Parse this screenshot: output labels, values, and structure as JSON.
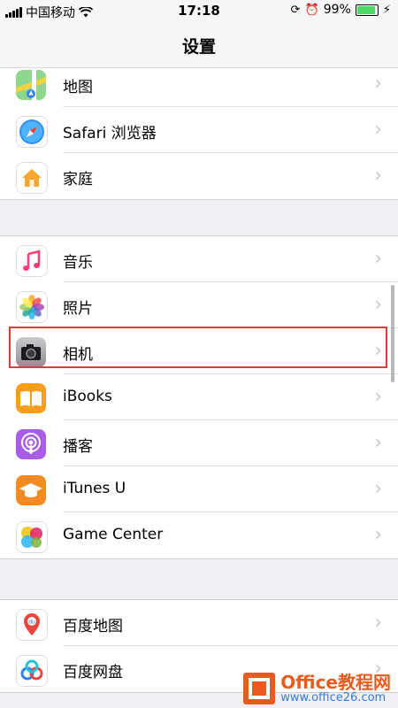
{
  "status_bar": {
    "carrier": "中国移动",
    "time": "17:18",
    "battery": "99%"
  },
  "nav": {
    "title": "设置"
  },
  "groups": [
    {
      "items": [
        {
          "label": "地图",
          "icon": "maps-icon"
        },
        {
          "label": "Safari 浏览器",
          "icon": "safari-icon"
        },
        {
          "label": "家庭",
          "icon": "home-icon"
        }
      ]
    },
    {
      "items": [
        {
          "label": "音乐",
          "icon": "music-icon"
        },
        {
          "label": "照片",
          "icon": "photos-icon"
        },
        {
          "label": "相机",
          "icon": "camera-icon"
        },
        {
          "label": "iBooks",
          "icon": "ibooks-icon"
        },
        {
          "label": "播客",
          "icon": "podcasts-icon"
        },
        {
          "label": "iTunes U",
          "icon": "itunes-u-icon"
        },
        {
          "label": "Game Center",
          "icon": "game-center-icon"
        }
      ]
    },
    {
      "items": [
        {
          "label": "百度地图",
          "icon": "baidu-maps-icon"
        },
        {
          "label": "百度网盘",
          "icon": "baidu-netdisk-icon"
        }
      ]
    }
  ],
  "highlight_color": "#e33b3b",
  "watermark": {
    "line1": "Office教程网",
    "line2": "www.office26.com"
  }
}
